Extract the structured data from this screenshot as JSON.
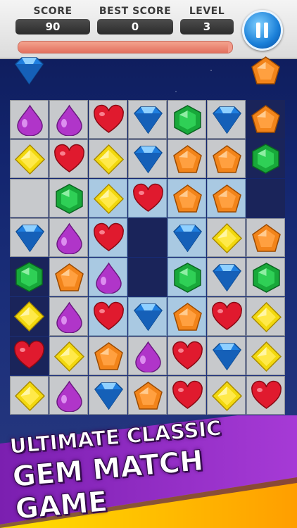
{
  "hud": {
    "score_label": "SCORE",
    "score_value": "90",
    "best_label": "BEST SCORE",
    "best_value": "0",
    "level_label": "LEVEL",
    "level_value": "3",
    "progress_fraction": 0.98
  },
  "banner": {
    "line1": "ULTIMATE CLASSIC",
    "line2": "GEM MATCH GAME"
  },
  "colors": {
    "purple": "#b035c9",
    "red": "#e01a2e",
    "blue": "#1f7fe0",
    "green": "#18a83a",
    "yellow": "#f2d80e",
    "orange": "#f2841a"
  },
  "board": {
    "rows": [
      [
        {
          "bg": "g",
          "gem": "purple"
        },
        {
          "bg": "g",
          "gem": "purple"
        },
        {
          "bg": "g",
          "gem": "red"
        },
        {
          "bg": "g",
          "gem": "blue"
        },
        {
          "bg": "g",
          "gem": "green"
        },
        {
          "bg": "g",
          "gem": "blue"
        },
        {
          "bg": "d",
          "gem": "orange"
        }
      ],
      [
        {
          "bg": "g",
          "gem": "yellow"
        },
        {
          "bg": "g",
          "gem": "red"
        },
        {
          "bg": "g",
          "gem": "yellow"
        },
        {
          "bg": "g",
          "gem": "blue"
        },
        {
          "bg": "g",
          "gem": "orange"
        },
        {
          "bg": "g",
          "gem": "orange"
        },
        {
          "bg": "d",
          "gem": "green"
        }
      ],
      [
        {
          "bg": "g",
          "gem": ""
        },
        {
          "bg": "g",
          "gem": "green"
        },
        {
          "bg": "b",
          "gem": "yellow"
        },
        {
          "bg": "b",
          "gem": "red"
        },
        {
          "bg": "b",
          "gem": "orange"
        },
        {
          "bg": "b",
          "gem": "orange"
        },
        {
          "bg": "d",
          "gem": ""
        }
      ],
      [
        {
          "bg": "g",
          "gem": "blue"
        },
        {
          "bg": "g",
          "gem": "purple"
        },
        {
          "bg": "b",
          "gem": "red"
        },
        {
          "bg": "d",
          "gem": ""
        },
        {
          "bg": "b",
          "gem": "blue"
        },
        {
          "bg": "g",
          "gem": "yellow"
        },
        {
          "bg": "g",
          "gem": "orange"
        }
      ],
      [
        {
          "bg": "d",
          "gem": "green"
        },
        {
          "bg": "g",
          "gem": "orange"
        },
        {
          "bg": "b",
          "gem": "purple"
        },
        {
          "bg": "d",
          "gem": ""
        },
        {
          "bg": "b",
          "gem": "green"
        },
        {
          "bg": "g",
          "gem": "blue"
        },
        {
          "bg": "g",
          "gem": "green"
        }
      ],
      [
        {
          "bg": "d",
          "gem": "yellow"
        },
        {
          "bg": "g",
          "gem": "purple"
        },
        {
          "bg": "b",
          "gem": "red"
        },
        {
          "bg": "b",
          "gem": "blue"
        },
        {
          "bg": "b",
          "gem": "orange"
        },
        {
          "bg": "g",
          "gem": "red"
        },
        {
          "bg": "g",
          "gem": "yellow"
        }
      ],
      [
        {
          "bg": "d",
          "gem": "red"
        },
        {
          "bg": "g",
          "gem": "yellow"
        },
        {
          "bg": "g",
          "gem": "orange"
        },
        {
          "bg": "g",
          "gem": "purple"
        },
        {
          "bg": "g",
          "gem": "red"
        },
        {
          "bg": "g",
          "gem": "blue"
        },
        {
          "bg": "g",
          "gem": "yellow"
        }
      ],
      [
        {
          "bg": "g",
          "gem": "yellow"
        },
        {
          "bg": "g",
          "gem": "purple"
        },
        {
          "bg": "g",
          "gem": "blue"
        },
        {
          "bg": "g",
          "gem": "orange"
        },
        {
          "bg": "g",
          "gem": "red"
        },
        {
          "bg": "g",
          "gem": "yellow"
        },
        {
          "bg": "g",
          "gem": "red"
        }
      ]
    ],
    "falling": [
      {
        "col": 0,
        "gem": "blue"
      },
      {
        "col": 6,
        "gem": "orange"
      }
    ]
  }
}
